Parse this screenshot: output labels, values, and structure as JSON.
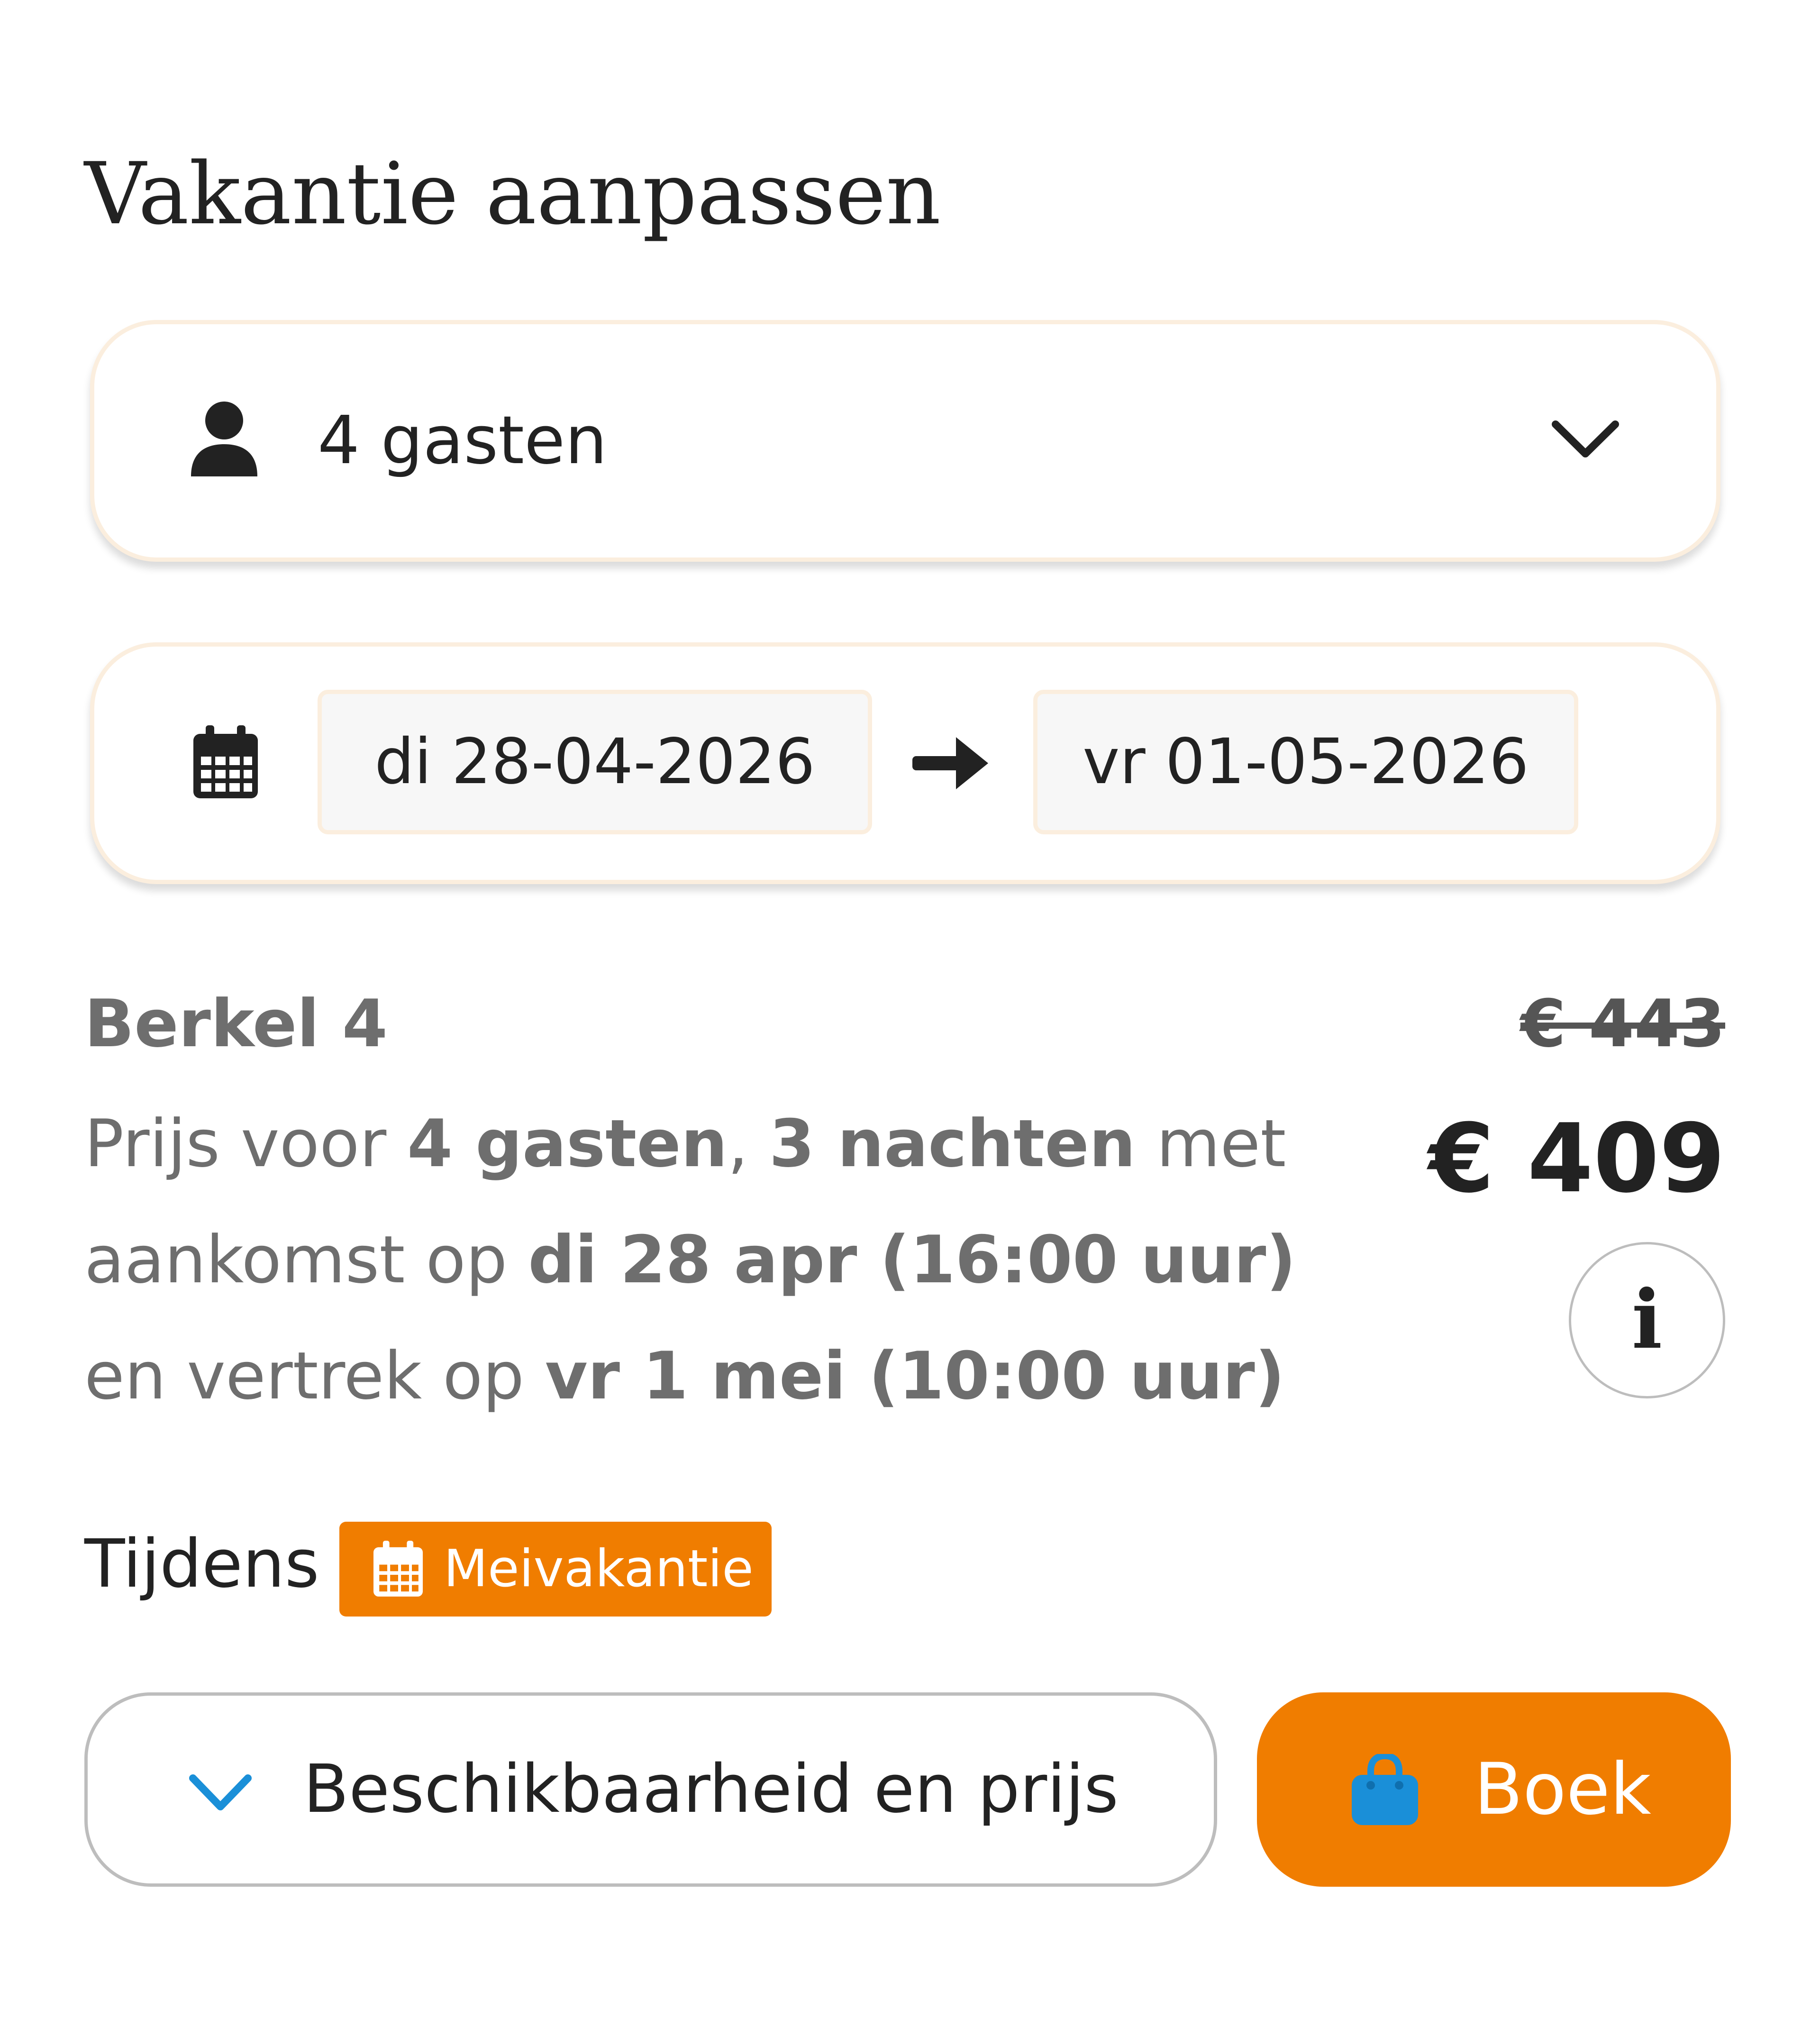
{
  "page": {
    "title": "Vakantie aanpassen"
  },
  "guests": {
    "label": "4 gasten",
    "icon": "person-icon",
    "dropdown_icon": "chevron-down-icon"
  },
  "dates": {
    "icon": "calendar-icon",
    "from": "di 28-04-2026",
    "to": "vr 01-05-2026",
    "separator_icon": "arrow-right-icon"
  },
  "accommodation": {
    "name": "Berkel 4",
    "price_text": {
      "p1": "Prijs voor ",
      "guests": "4 gasten",
      "p2": ", ",
      "nights": "3 nachten",
      "p3": " met aankomst op ",
      "arrival": "di 28 apr (16:00 uur)",
      "p4": " en vertrek op ",
      "departure": "vr 1 mei (10:00 uur)"
    },
    "old_price": "€ 443",
    "price": "€ 409",
    "info_label": "i"
  },
  "period": {
    "prefix": "Tijdens",
    "badge": "Meivakantie",
    "badge_color": "#f07d00"
  },
  "actions": {
    "availability_label": "Beschikbaarheid en prijs",
    "book_label": "Boek",
    "accent_color": "#f07d00",
    "icon_blue": "#1a8fd8"
  }
}
